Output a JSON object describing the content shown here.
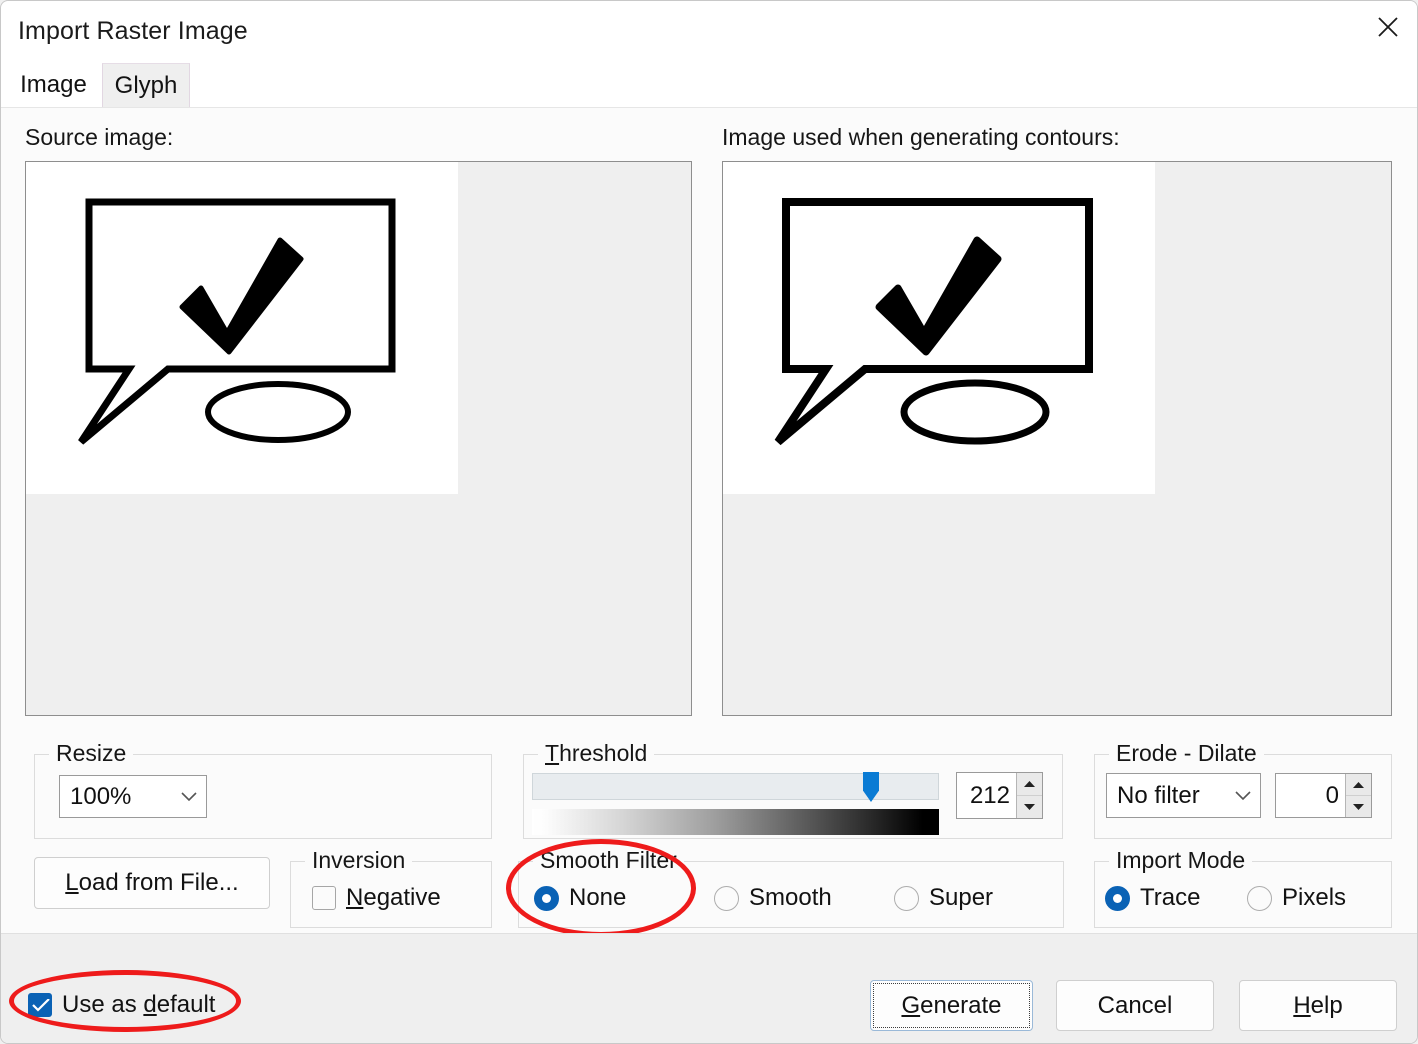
{
  "window": {
    "title": "Import Raster Image",
    "close_icon": "close-icon"
  },
  "tabs": [
    {
      "label": "Image",
      "active": true
    },
    {
      "label": "Glyph",
      "active": false
    }
  ],
  "previews": {
    "source_label": "Source image:",
    "contour_label": "Image used when generating contours:"
  },
  "resize": {
    "title": "Resize",
    "value": "100%"
  },
  "threshold": {
    "title": "Threshold",
    "title_accel": "T",
    "value": "212",
    "slider_percent": 83
  },
  "erode_dilate": {
    "title": "Erode - Dilate",
    "filter_value": "No filter",
    "amount": "0"
  },
  "load_button": {
    "label": "Load from File...",
    "accel": "L"
  },
  "inversion": {
    "title": "Inversion",
    "negative_label": "Negative",
    "negative_accel": "N",
    "negative_checked": false
  },
  "smooth_filter": {
    "title": "Smooth Filter",
    "options": [
      {
        "label": "None",
        "selected": true
      },
      {
        "label": "Smooth",
        "selected": false
      },
      {
        "label": "Super",
        "selected": false
      }
    ]
  },
  "import_mode": {
    "title": "Import Mode",
    "options": [
      {
        "label": "Trace",
        "selected": true
      },
      {
        "label": "Pixels",
        "selected": false
      }
    ]
  },
  "footer": {
    "use_as_default_label": "Use as default",
    "use_as_default_accel": "d",
    "use_as_default_checked": true,
    "generate_label": "Generate",
    "generate_accel": "G",
    "cancel_label": "Cancel",
    "help_label": "Help",
    "help_accel": "H"
  },
  "annotations": {
    "color": "#ee1b1b",
    "items": [
      {
        "target": "smooth-filter-group"
      },
      {
        "target": "use-as-default-checkbox"
      }
    ]
  }
}
